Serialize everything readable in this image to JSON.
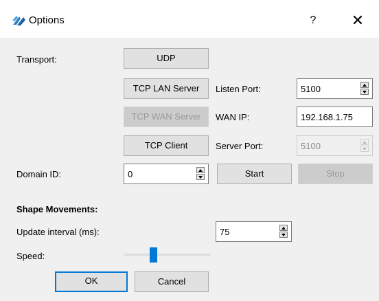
{
  "window": {
    "title": "Options",
    "help_label": "?",
    "close_label": "✕"
  },
  "transport": {
    "label": "Transport:",
    "udp_button": "UDP",
    "tcp_lan_button": "TCP LAN Server",
    "tcp_wan_button": "TCP WAN Server",
    "tcp_client_button": "TCP Client",
    "listen_port_label": "Listen Port:",
    "listen_port_value": "5100",
    "wan_ip_label": "WAN IP:",
    "wan_ip_value": "192.168.1.75",
    "server_port_label": "Server Port:",
    "server_port_value": "5100"
  },
  "domain": {
    "label": "Domain ID:",
    "value": "0",
    "start_button": "Start",
    "stop_button": "Stop"
  },
  "shape_movements": {
    "title": "Shape Movements:",
    "update_interval_label": "Update interval (ms):",
    "update_interval_value": "75",
    "speed_label": "Speed:",
    "speed_level": 0.33
  },
  "footer": {
    "ok_button": "OK",
    "cancel_button": "Cancel"
  },
  "colors": {
    "accent": "#0078d7",
    "titlebar": "#ffffff",
    "background": "#f0f0f0"
  }
}
